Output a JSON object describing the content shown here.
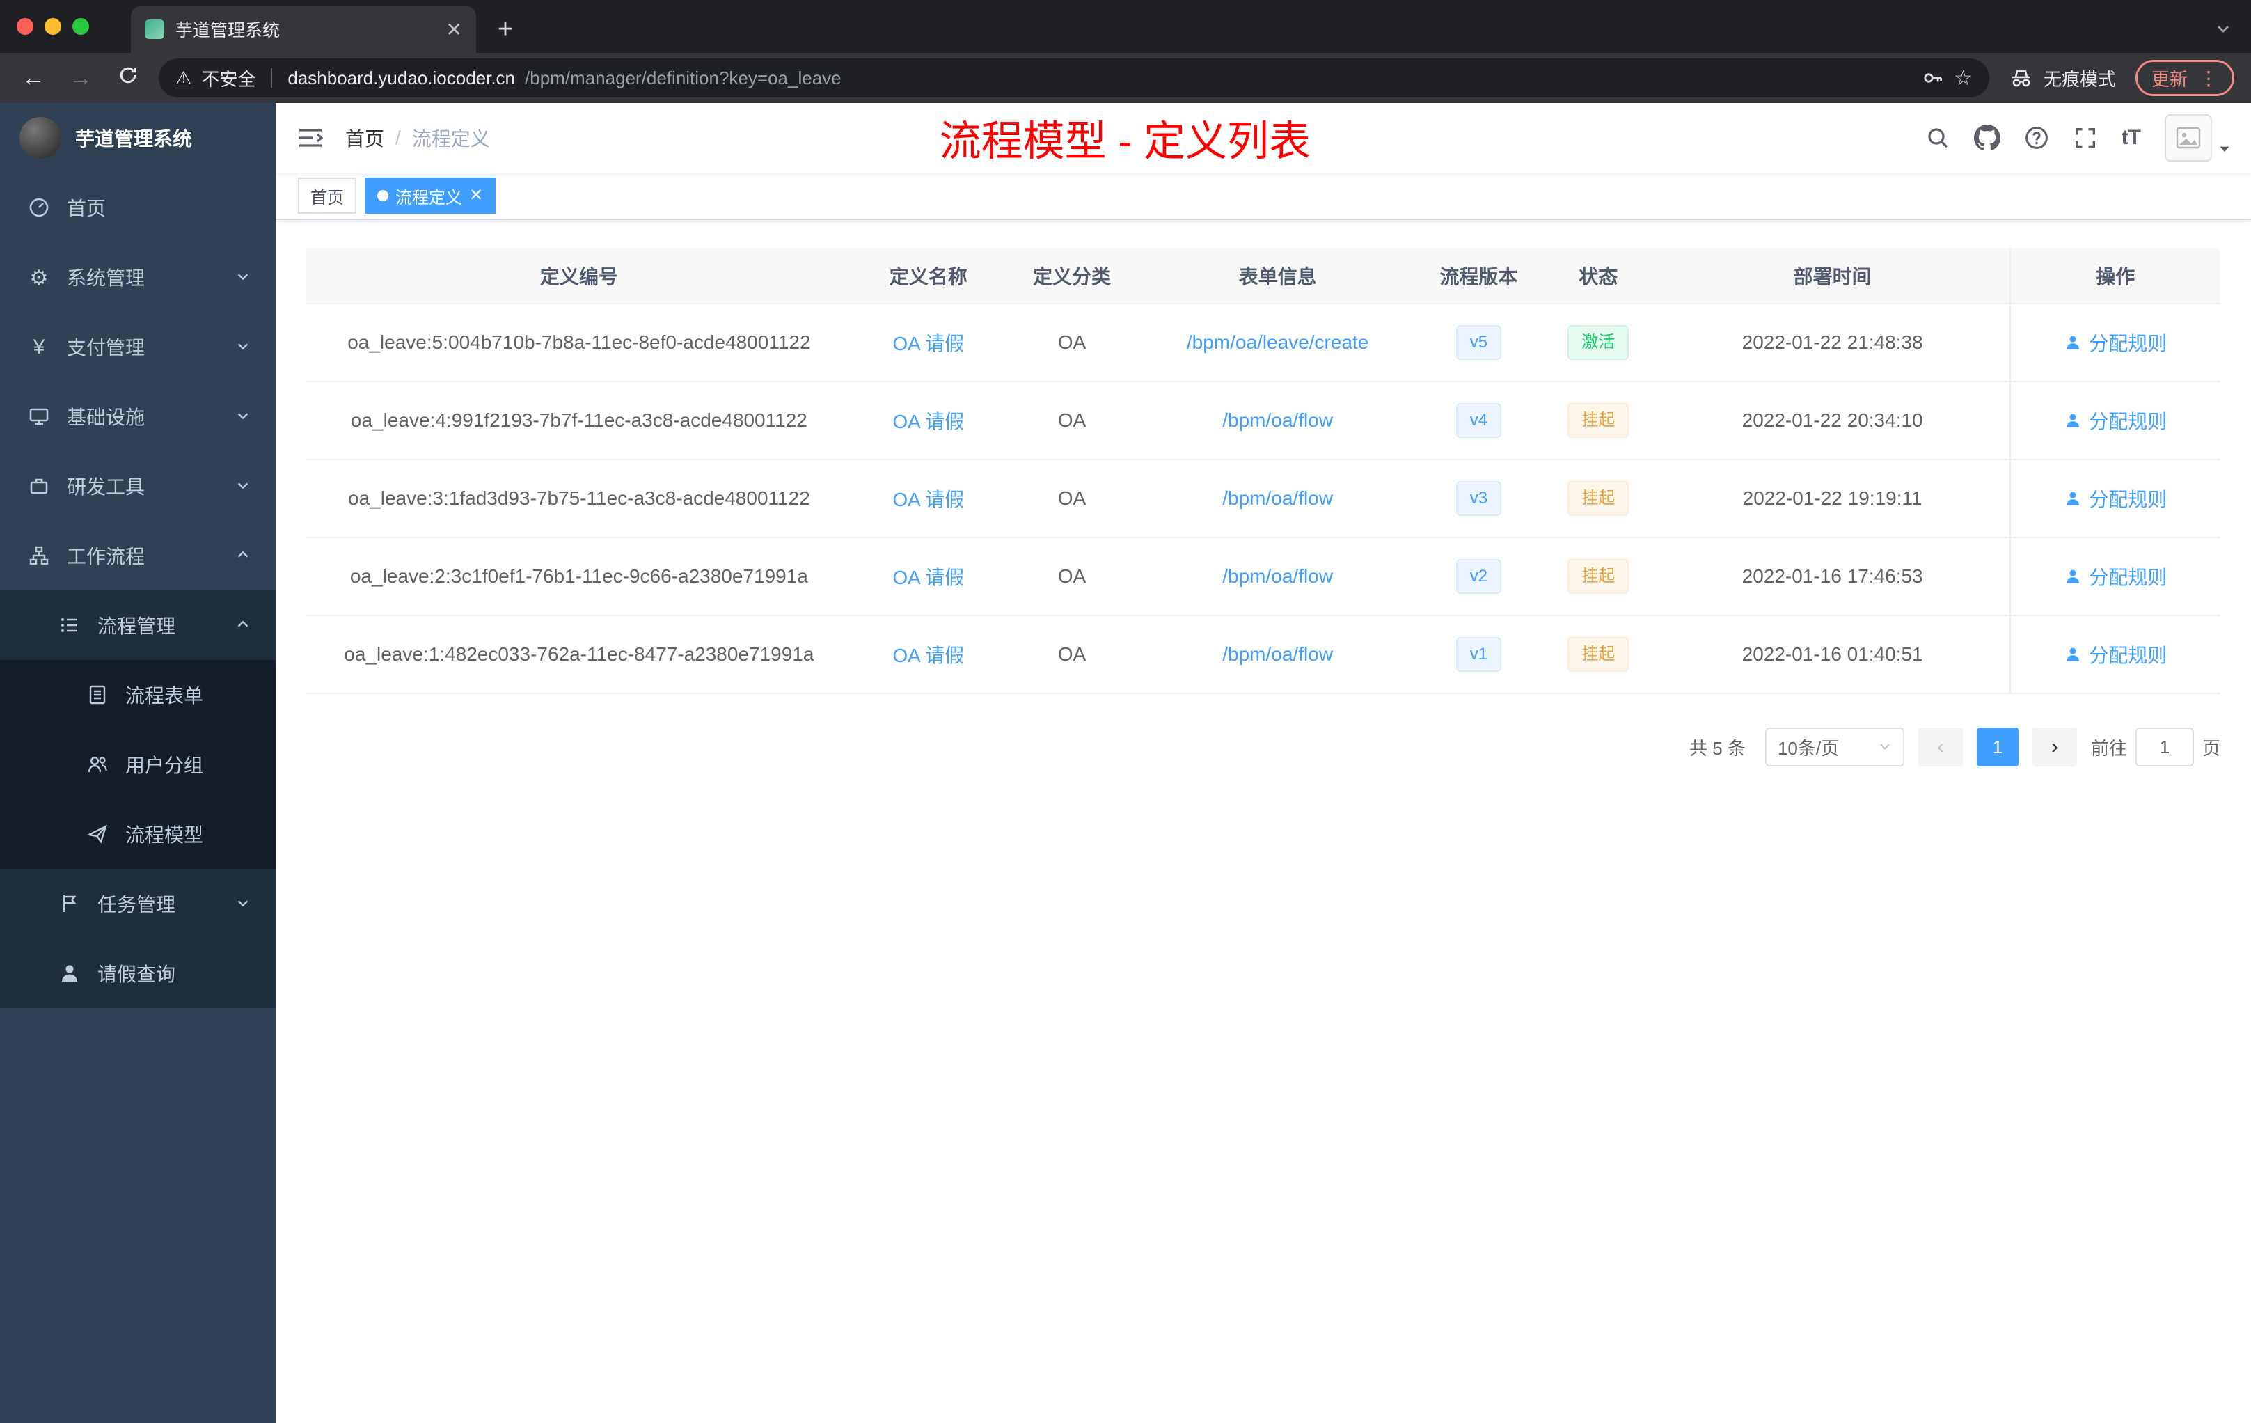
{
  "colors": {
    "accent": "#409eff",
    "success": "#13ce66",
    "warning": "#e6a23c",
    "title_red": "#ff0000",
    "sidebar_bg": "#304156"
  },
  "browser": {
    "tab_title": "芋道管理系统",
    "security_label": "不安全",
    "url_domain": "dashboard.yudao.iocoder.cn",
    "url_path": "/bpm/manager/definition?key=oa_leave",
    "incognito_label": "无痕模式",
    "update_label": "更新"
  },
  "sidebar": {
    "logo_title": "芋道管理系统",
    "items": [
      {
        "label": "首页"
      },
      {
        "label": "系统管理"
      },
      {
        "label": "支付管理"
      },
      {
        "label": "基础设施"
      },
      {
        "label": "研发工具"
      },
      {
        "label": "工作流程"
      },
      {
        "label": "流程管理"
      },
      {
        "label": "流程表单"
      },
      {
        "label": "用户分组"
      },
      {
        "label": "流程模型"
      },
      {
        "label": "任务管理"
      },
      {
        "label": "请假查询"
      }
    ]
  },
  "header": {
    "breadcrumb_home": "首页",
    "breadcrumb_separator": "/",
    "breadcrumb_current": "流程定义",
    "overlay_title": "流程模型 - 定义列表",
    "font_size_glyph": "tT"
  },
  "tags": {
    "home_label": "首页",
    "active_label": "流程定义"
  },
  "table": {
    "columns": [
      "定义编号",
      "定义名称",
      "定义分类",
      "表单信息",
      "流程版本",
      "状态",
      "部署时间",
      "操作"
    ],
    "rows": [
      {
        "id": "oa_leave:5:004b710b-7b8a-11ec-8ef0-acde48001122",
        "name": "OA 请假",
        "category": "OA",
        "form": "/bpm/oa/leave/create",
        "version": "v5",
        "status": "激活",
        "status_type": "success",
        "time": "2022-01-22 21:48:38",
        "action": "分配规则"
      },
      {
        "id": "oa_leave:4:991f2193-7b7f-11ec-a3c8-acde48001122",
        "name": "OA 请假",
        "category": "OA",
        "form": "/bpm/oa/flow",
        "version": "v4",
        "status": "挂起",
        "status_type": "warning",
        "time": "2022-01-22 20:34:10",
        "action": "分配规则"
      },
      {
        "id": "oa_leave:3:1fad3d93-7b75-11ec-a3c8-acde48001122",
        "name": "OA 请假",
        "category": "OA",
        "form": "/bpm/oa/flow",
        "version": "v3",
        "status": "挂起",
        "status_type": "warning",
        "time": "2022-01-22 19:19:11",
        "action": "分配规则"
      },
      {
        "id": "oa_leave:2:3c1f0ef1-76b1-11ec-9c66-a2380e71991a",
        "name": "OA 请假",
        "category": "OA",
        "form": "/bpm/oa/flow",
        "version": "v2",
        "status": "挂起",
        "status_type": "warning",
        "time": "2022-01-16 17:46:53",
        "action": "分配规则"
      },
      {
        "id": "oa_leave:1:482ec033-762a-11ec-8477-a2380e71991a",
        "name": "OA 请假",
        "category": "OA",
        "form": "/bpm/oa/flow",
        "version": "v1",
        "status": "挂起",
        "status_type": "warning",
        "time": "2022-01-16 01:40:51",
        "action": "分配规则"
      }
    ]
  },
  "pagination": {
    "total": "共 5 条",
    "page_size": "10条/页",
    "current_page": "1",
    "goto_label": "前往",
    "goto_value": "1",
    "page_unit": "页"
  }
}
